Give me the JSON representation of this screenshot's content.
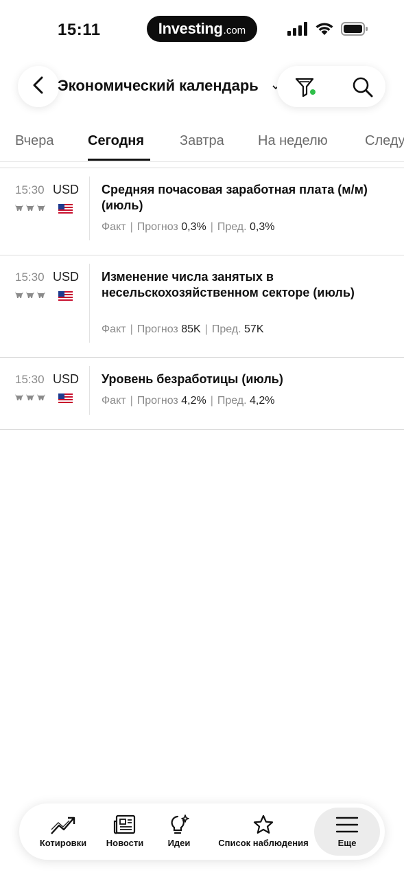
{
  "status_bar": {
    "time": "15:11",
    "brand_main": "Investing",
    "brand_sub": ".com",
    "icons": [
      "cellular-signal-icon",
      "wifi-icon",
      "battery-icon"
    ]
  },
  "header": {
    "title": "Экономический календарь",
    "icons": [
      "back-arrow-icon",
      "chevron-down-icon",
      "filter-icon",
      "search-icon"
    ],
    "filter_active_color": "#2fbf4a"
  },
  "tabs": [
    {
      "label": "Вчера",
      "active": false
    },
    {
      "label": "Сегодня",
      "active": true
    },
    {
      "label": "Завтра",
      "active": false
    },
    {
      "label": "На неделю",
      "active": false
    },
    {
      "label": "Следу",
      "active": false
    }
  ],
  "events": [
    {
      "time": "15:30",
      "currency": "USD",
      "importance": 3,
      "flag": "us-flag-icon",
      "title": "Средняя почасовая заработная плата (м/м) (июль)",
      "actual_label": "Факт",
      "forecast_label": "Прогноз",
      "forecast": "0,3%",
      "previous_label": "Пред.",
      "previous": "0,3%"
    },
    {
      "time": "15:30",
      "currency": "USD",
      "importance": 3,
      "flag": "us-flag-icon",
      "title": "Изменение числа занятых в несельскохозяйственном секторе (июль)",
      "actual_label": "Факт",
      "forecast_label": "Прогноз",
      "forecast": "85K",
      "previous_label": "Пред.",
      "previous": "57K"
    },
    {
      "time": "15:30",
      "currency": "USD",
      "importance": 3,
      "flag": "us-flag-icon",
      "title": "Уровень безработицы (июль)",
      "actual_label": "Факт",
      "forecast_label": "Прогноз",
      "forecast": "4,2%",
      "previous_label": "Пред.",
      "previous": "4,2%"
    }
  ],
  "bottom_nav": [
    {
      "label": "Котировки",
      "icon": "trending-chart-icon",
      "active": false
    },
    {
      "label": "Новости",
      "icon": "newspaper-icon",
      "active": false
    },
    {
      "label": "Идеи",
      "icon": "lightbulb-icon",
      "active": false
    },
    {
      "label": "Список наблюдения",
      "icon": "star-icon",
      "active": false
    },
    {
      "label": "Еще",
      "icon": "menu-icon",
      "active": true
    }
  ]
}
